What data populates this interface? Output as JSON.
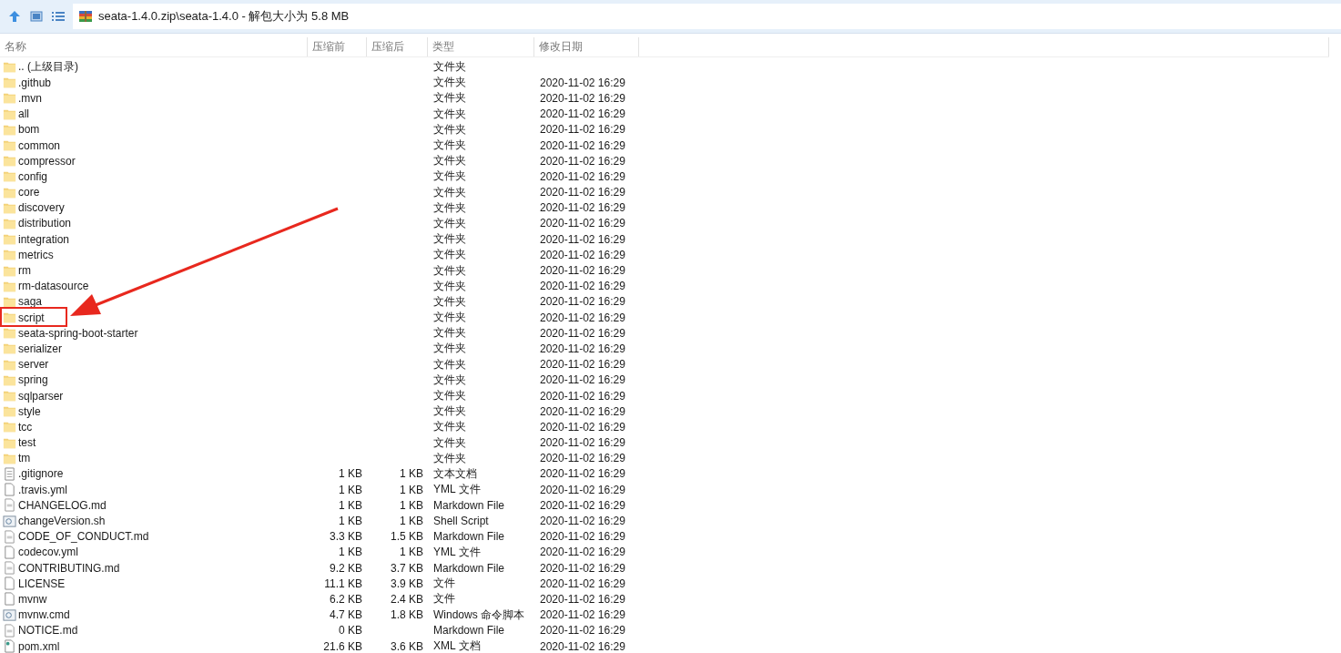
{
  "toolbar": {
    "path": "seata-1.4.0.zip\\seata-1.4.0 - 解包大小为 5.8 MB"
  },
  "columns": [
    "名称",
    "压缩前",
    "压缩后",
    "类型",
    "修改日期"
  ],
  "rows": [
    {
      "kind": "folder",
      "name": ".. (上级目录)",
      "size": "",
      "packed": "",
      "type": "文件夹",
      "date": "",
      "highlighted": false
    },
    {
      "kind": "folder",
      "name": ".github",
      "size": "",
      "packed": "",
      "type": "文件夹",
      "date": "2020-11-02 16:29",
      "highlighted": false
    },
    {
      "kind": "folder",
      "name": ".mvn",
      "size": "",
      "packed": "",
      "type": "文件夹",
      "date": "2020-11-02 16:29",
      "highlighted": false
    },
    {
      "kind": "folder",
      "name": "all",
      "size": "",
      "packed": "",
      "type": "文件夹",
      "date": "2020-11-02 16:29",
      "highlighted": false
    },
    {
      "kind": "folder",
      "name": "bom",
      "size": "",
      "packed": "",
      "type": "文件夹",
      "date": "2020-11-02 16:29",
      "highlighted": false
    },
    {
      "kind": "folder",
      "name": "common",
      "size": "",
      "packed": "",
      "type": "文件夹",
      "date": "2020-11-02 16:29",
      "highlighted": false
    },
    {
      "kind": "folder",
      "name": "compressor",
      "size": "",
      "packed": "",
      "type": "文件夹",
      "date": "2020-11-02 16:29",
      "highlighted": false
    },
    {
      "kind": "folder",
      "name": "config",
      "size": "",
      "packed": "",
      "type": "文件夹",
      "date": "2020-11-02 16:29",
      "highlighted": false
    },
    {
      "kind": "folder",
      "name": "core",
      "size": "",
      "packed": "",
      "type": "文件夹",
      "date": "2020-11-02 16:29",
      "highlighted": false
    },
    {
      "kind": "folder",
      "name": "discovery",
      "size": "",
      "packed": "",
      "type": "文件夹",
      "date": "2020-11-02 16:29",
      "highlighted": false
    },
    {
      "kind": "folder",
      "name": "distribution",
      "size": "",
      "packed": "",
      "type": "文件夹",
      "date": "2020-11-02 16:29",
      "highlighted": false
    },
    {
      "kind": "folder",
      "name": "integration",
      "size": "",
      "packed": "",
      "type": "文件夹",
      "date": "2020-11-02 16:29",
      "highlighted": false
    },
    {
      "kind": "folder",
      "name": "metrics",
      "size": "",
      "packed": "",
      "type": "文件夹",
      "date": "2020-11-02 16:29",
      "highlighted": false
    },
    {
      "kind": "folder",
      "name": "rm",
      "size": "",
      "packed": "",
      "type": "文件夹",
      "date": "2020-11-02 16:29",
      "highlighted": false
    },
    {
      "kind": "folder",
      "name": "rm-datasource",
      "size": "",
      "packed": "",
      "type": "文件夹",
      "date": "2020-11-02 16:29",
      "highlighted": false
    },
    {
      "kind": "folder",
      "name": "saga",
      "size": "",
      "packed": "",
      "type": "文件夹",
      "date": "2020-11-02 16:29",
      "highlighted": false
    },
    {
      "kind": "folder",
      "name": "script",
      "size": "",
      "packed": "",
      "type": "文件夹",
      "date": "2020-11-02 16:29",
      "highlighted": true
    },
    {
      "kind": "folder",
      "name": "seata-spring-boot-starter",
      "size": "",
      "packed": "",
      "type": "文件夹",
      "date": "2020-11-02 16:29",
      "highlighted": false
    },
    {
      "kind": "folder",
      "name": "serializer",
      "size": "",
      "packed": "",
      "type": "文件夹",
      "date": "2020-11-02 16:29",
      "highlighted": false
    },
    {
      "kind": "folder",
      "name": "server",
      "size": "",
      "packed": "",
      "type": "文件夹",
      "date": "2020-11-02 16:29",
      "highlighted": false
    },
    {
      "kind": "folder",
      "name": "spring",
      "size": "",
      "packed": "",
      "type": "文件夹",
      "date": "2020-11-02 16:29",
      "highlighted": false
    },
    {
      "kind": "folder",
      "name": "sqlparser",
      "size": "",
      "packed": "",
      "type": "文件夹",
      "date": "2020-11-02 16:29",
      "highlighted": false
    },
    {
      "kind": "folder",
      "name": "style",
      "size": "",
      "packed": "",
      "type": "文件夹",
      "date": "2020-11-02 16:29",
      "highlighted": false
    },
    {
      "kind": "folder",
      "name": "tcc",
      "size": "",
      "packed": "",
      "type": "文件夹",
      "date": "2020-11-02 16:29",
      "highlighted": false
    },
    {
      "kind": "folder",
      "name": "test",
      "size": "",
      "packed": "",
      "type": "文件夹",
      "date": "2020-11-02 16:29",
      "highlighted": false
    },
    {
      "kind": "folder",
      "name": "tm",
      "size": "",
      "packed": "",
      "type": "文件夹",
      "date": "2020-11-02 16:29",
      "highlighted": false
    },
    {
      "kind": "text",
      "name": ".gitignore",
      "size": "1 KB",
      "packed": "1 KB",
      "type": "文本文档",
      "date": "2020-11-02 16:29",
      "highlighted": false
    },
    {
      "kind": "blank",
      "name": ".travis.yml",
      "size": "1 KB",
      "packed": "1 KB",
      "type": "YML 文件",
      "date": "2020-11-02 16:29",
      "highlighted": false
    },
    {
      "kind": "doc",
      "name": "CHANGELOG.md",
      "size": "1 KB",
      "packed": "1 KB",
      "type": "Markdown File",
      "date": "2020-11-02 16:29",
      "highlighted": false
    },
    {
      "kind": "script",
      "name": "changeVersion.sh",
      "size": "1 KB",
      "packed": "1 KB",
      "type": "Shell Script",
      "date": "2020-11-02 16:29",
      "highlighted": false
    },
    {
      "kind": "doc",
      "name": "CODE_OF_CONDUCT.md",
      "size": "3.3 KB",
      "packed": "1.5 KB",
      "type": "Markdown File",
      "date": "2020-11-02 16:29",
      "highlighted": false
    },
    {
      "kind": "blank",
      "name": "codecov.yml",
      "size": "1 KB",
      "packed": "1 KB",
      "type": "YML 文件",
      "date": "2020-11-02 16:29",
      "highlighted": false
    },
    {
      "kind": "doc",
      "name": "CONTRIBUTING.md",
      "size": "9.2 KB",
      "packed": "3.7 KB",
      "type": "Markdown File",
      "date": "2020-11-02 16:29",
      "highlighted": false
    },
    {
      "kind": "blank",
      "name": "LICENSE",
      "size": "11.1 KB",
      "packed": "3.9 KB",
      "type": "文件",
      "date": "2020-11-02 16:29",
      "highlighted": false
    },
    {
      "kind": "blank",
      "name": "mvnw",
      "size": "6.2 KB",
      "packed": "2.4 KB",
      "type": "文件",
      "date": "2020-11-02 16:29",
      "highlighted": false
    },
    {
      "kind": "script",
      "name": "mvnw.cmd",
      "size": "4.7 KB",
      "packed": "1.8 KB",
      "type": "Windows 命令脚本",
      "date": "2020-11-02 16:29",
      "highlighted": false
    },
    {
      "kind": "doc",
      "name": "NOTICE.md",
      "size": "0 KB",
      "packed": "",
      "type": "Markdown File",
      "date": "2020-11-02 16:29",
      "highlighted": false
    },
    {
      "kind": "xml",
      "name": "pom.xml",
      "size": "21.6 KB",
      "packed": "3.6 KB",
      "type": "XML 文档",
      "date": "2020-11-02 16:29",
      "highlighted": false
    }
  ]
}
